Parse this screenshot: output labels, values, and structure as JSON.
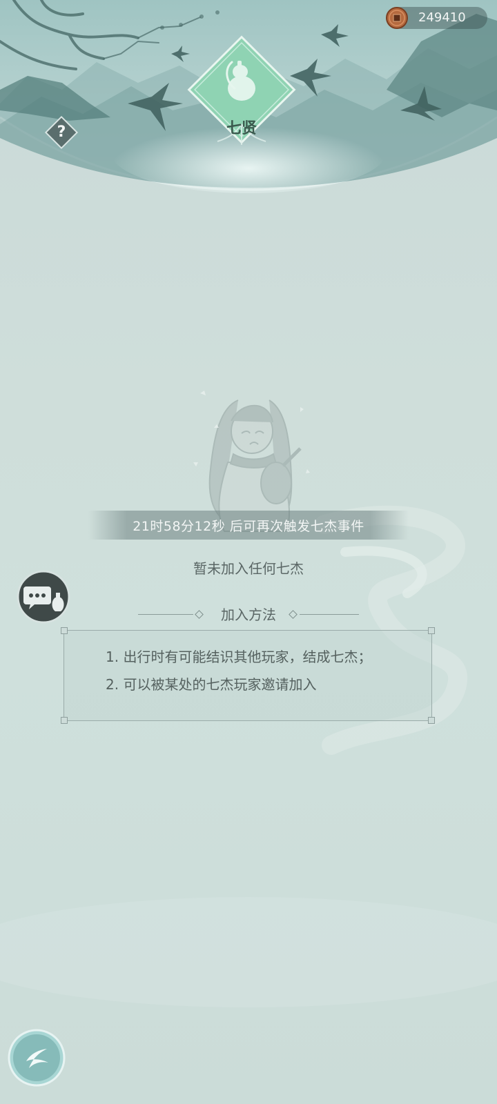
{
  "currency": {
    "value": "249410",
    "icon": "copper-coin-icon"
  },
  "emblem": {
    "label": "七贤",
    "icon": "gourd-emblem-icon"
  },
  "help": {
    "icon": "question-mark-icon",
    "symbol": "?"
  },
  "cooldown": {
    "text": "21时58分12秒  后可再次触发七杰事件"
  },
  "status": {
    "text": "暂未加入任何七杰"
  },
  "join_method": {
    "title": "加入方法",
    "items": [
      "1. 出行时有可能结识其他玩家，结成七杰；",
      "2. 可以被某处的七杰玩家邀请加入"
    ]
  },
  "chat": {
    "icon": "chat-bubble-icon"
  },
  "back": {
    "icon": "back-arrow-icon"
  },
  "colors": {
    "background": "#cfdeda",
    "accent_jade": "#7fcaa8",
    "text": "#5a6665",
    "cooldown_bg": "#6e8282"
  }
}
